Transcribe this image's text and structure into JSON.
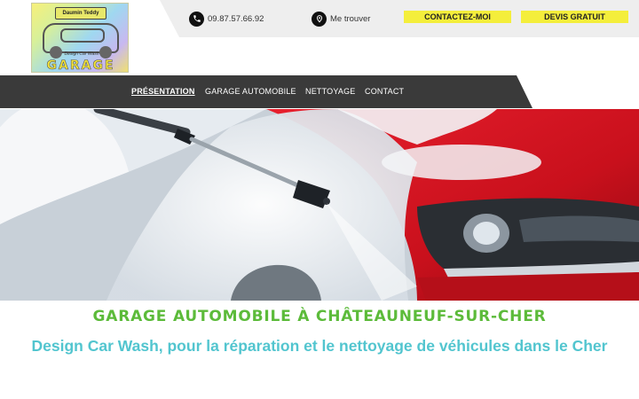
{
  "logo": {
    "plate_text": "Daumin Teddy",
    "subtitle": "Design Car Wash",
    "wordmark": "GARAGE",
    "icon": "car-logo"
  },
  "topbar": {
    "phone": {
      "icon": "phone-icon",
      "text": "09.87.57.66.92"
    },
    "location": {
      "icon": "location-pin-icon",
      "text": "Me trouver"
    },
    "contact_button": "CONTACTEZ-MOI",
    "quote_button": "DEVIS GRATUIT"
  },
  "nav": {
    "items": [
      {
        "label": "PRÉSENTATION",
        "active": true
      },
      {
        "label": "GARAGE AUTOMOBILE",
        "active": false
      },
      {
        "label": "NETTOYAGE",
        "active": false
      },
      {
        "label": "CONTACT",
        "active": false
      }
    ]
  },
  "hero": {
    "image": "pressure-washer-foam-on-red-car"
  },
  "main": {
    "title": "GARAGE AUTOMOBILE À CHÂTEAUNEUF-SUR-CHER",
    "subtitle": "Design Car Wash, pour la réparation et le nettoyage de véhicules dans le Cher"
  },
  "colors": {
    "accent_yellow": "#f4ee3b",
    "nav_bg": "#3a3a3a",
    "title_green": "#5cbb3a",
    "subtitle_teal": "#52c5cf",
    "topbar_bg": "#eeeeee"
  }
}
